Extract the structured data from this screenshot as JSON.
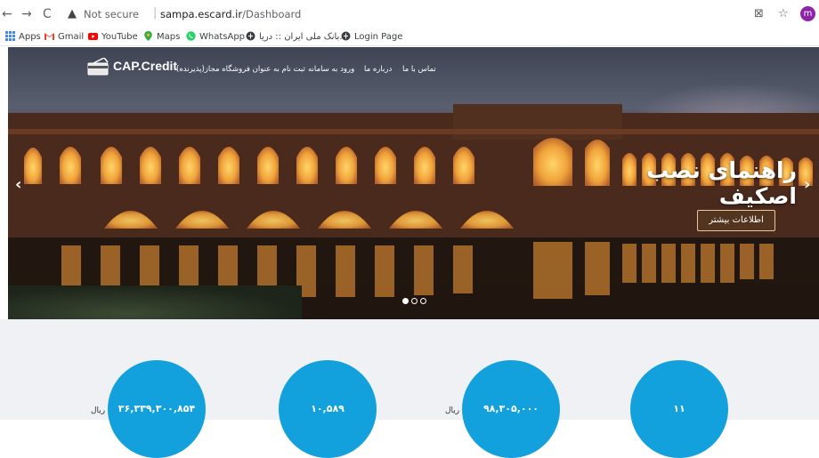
{
  "browser": {
    "url_warning": "Not secure",
    "url_host": "sampa.escard.ir",
    "url_path": "/Dashboard",
    "avatar_letter": "m",
    "bookmarks": [
      {
        "label": "Apps",
        "icon": "apps-grid-icon"
      },
      {
        "label": "Gmail",
        "icon": "gmail-icon"
      },
      {
        "label": "YouTube",
        "icon": "youtube-icon"
      },
      {
        "label": "Maps",
        "icon": "maps-icon"
      },
      {
        "label": "WhatsApp",
        "icon": "whatsapp-icon"
      },
      {
        "label": "بانک ملی ایران :: دریا...",
        "icon": "globe-icon"
      },
      {
        "label": "Login Page",
        "icon": "globe-icon"
      }
    ]
  },
  "site": {
    "logo_text": "CAP.Credit",
    "menu": [
      "تماس با ما",
      "درباره ما",
      "ورود به سامانه",
      "ثبت نام به عنوان فروشگاه مجاز(پذیرنده)"
    ]
  },
  "slider": {
    "title": "راهنمای نصب اصکیف",
    "button": "اطلاعات بیشتر",
    "slide_count": 3,
    "active_slide": 1
  },
  "stats": [
    {
      "value": "۳۶,۳۳۹,۳۰۰,۸۵۴",
      "unit": "ریال"
    },
    {
      "value": "۱۰,۵۸۹",
      "unit": ""
    },
    {
      "value": "۹۸,۳۰۵,۰۰۰",
      "unit": "ریال"
    },
    {
      "value": "۱۱",
      "unit": ""
    }
  ],
  "colors": {
    "accent": "#12a1dd",
    "stats_background": "#eff1f4",
    "avatar": "#8e24aa"
  }
}
